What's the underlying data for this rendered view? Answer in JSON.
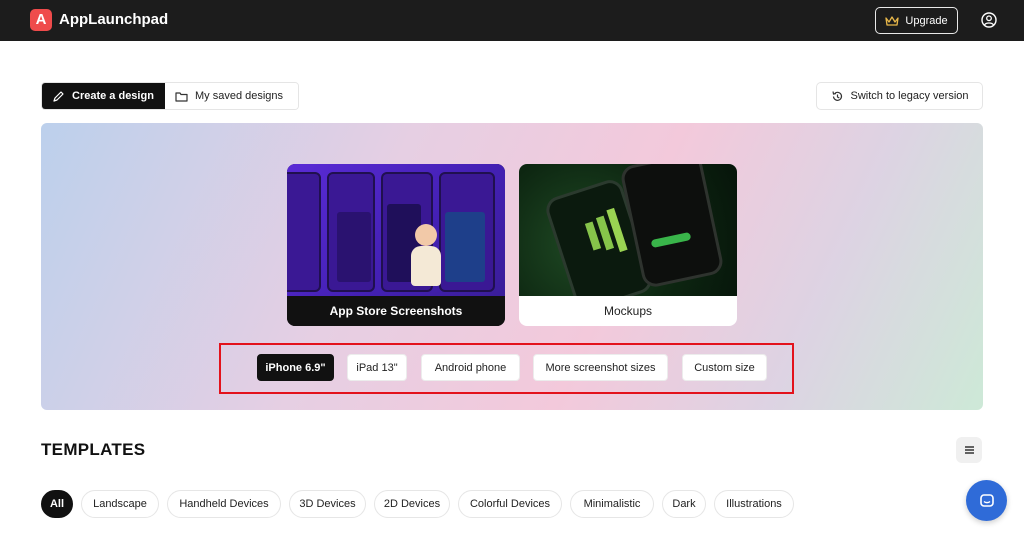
{
  "header": {
    "logo_letter": "A",
    "brand": "AppLaunchpad",
    "upgrade_label": "Upgrade",
    "icons": {
      "crown": "crown-icon",
      "account": "account-icon"
    }
  },
  "tabs": {
    "create": "Create a design",
    "saved": "My saved designs",
    "legacy": "Switch to legacy version"
  },
  "hero": {
    "cards": [
      {
        "label": "App Store Screenshots"
      },
      {
        "label": "Mockups"
      }
    ],
    "sizes": [
      {
        "label": "iPhone 6.9\"",
        "active": true
      },
      {
        "label": "iPad 13\"",
        "active": false
      },
      {
        "label": "Android phone",
        "active": false
      },
      {
        "label": "More screenshot sizes",
        "active": false
      },
      {
        "label": "Custom size",
        "active": false
      }
    ],
    "highlight_color": "#e3121c"
  },
  "templates": {
    "title": "TEMPLATES",
    "filters": [
      {
        "label": "All",
        "active": true
      },
      {
        "label": "Landscape",
        "active": false
      },
      {
        "label": "Handheld Devices",
        "active": false
      },
      {
        "label": "3D Devices",
        "active": false
      },
      {
        "label": "2D Devices",
        "active": false
      },
      {
        "label": "Colorful Devices",
        "active": false
      },
      {
        "label": "Minimalistic",
        "active": false
      },
      {
        "label": "Dark",
        "active": false
      },
      {
        "label": "Illustrations",
        "active": false
      }
    ]
  },
  "colors": {
    "topbar": "#1c1c1c",
    "logo": "#ef4b4b",
    "chat": "#2f6bd8"
  }
}
